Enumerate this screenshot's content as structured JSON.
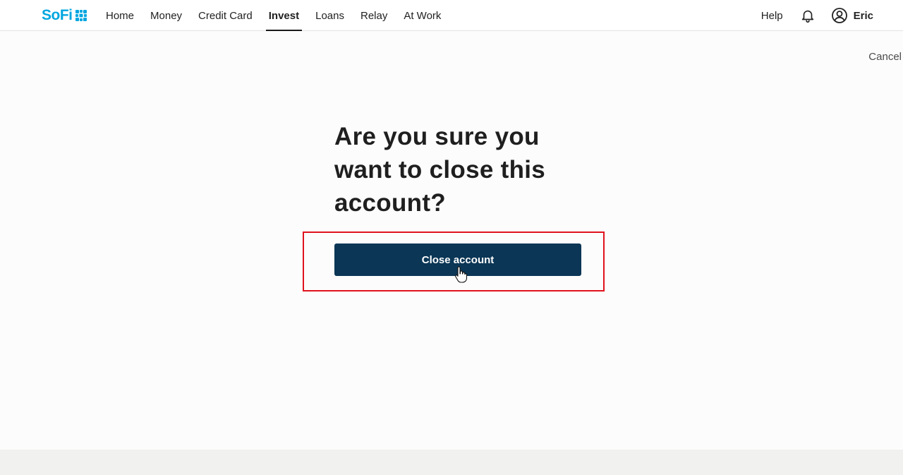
{
  "header": {
    "logo_text": "SoFi",
    "nav": [
      {
        "label": "Home",
        "active": false
      },
      {
        "label": "Money",
        "active": false
      },
      {
        "label": "Credit Card",
        "active": false
      },
      {
        "label": "Invest",
        "active": true
      },
      {
        "label": "Loans",
        "active": false
      },
      {
        "label": "Relay",
        "active": false
      },
      {
        "label": "At Work",
        "active": false
      }
    ],
    "help_label": "Help",
    "user_name": "Eric"
  },
  "page": {
    "cancel_label": "Cancel",
    "title": "Are you sure you want to close this account?",
    "close_button_label": "Close account"
  },
  "colors": {
    "logo_blue": "#00a6e0",
    "button_navy": "#0b3656",
    "highlight_red": "#e0121d"
  },
  "icons": [
    "sofi-logo-icon",
    "bell-icon",
    "user-circle-icon",
    "hand-cursor-icon"
  ]
}
